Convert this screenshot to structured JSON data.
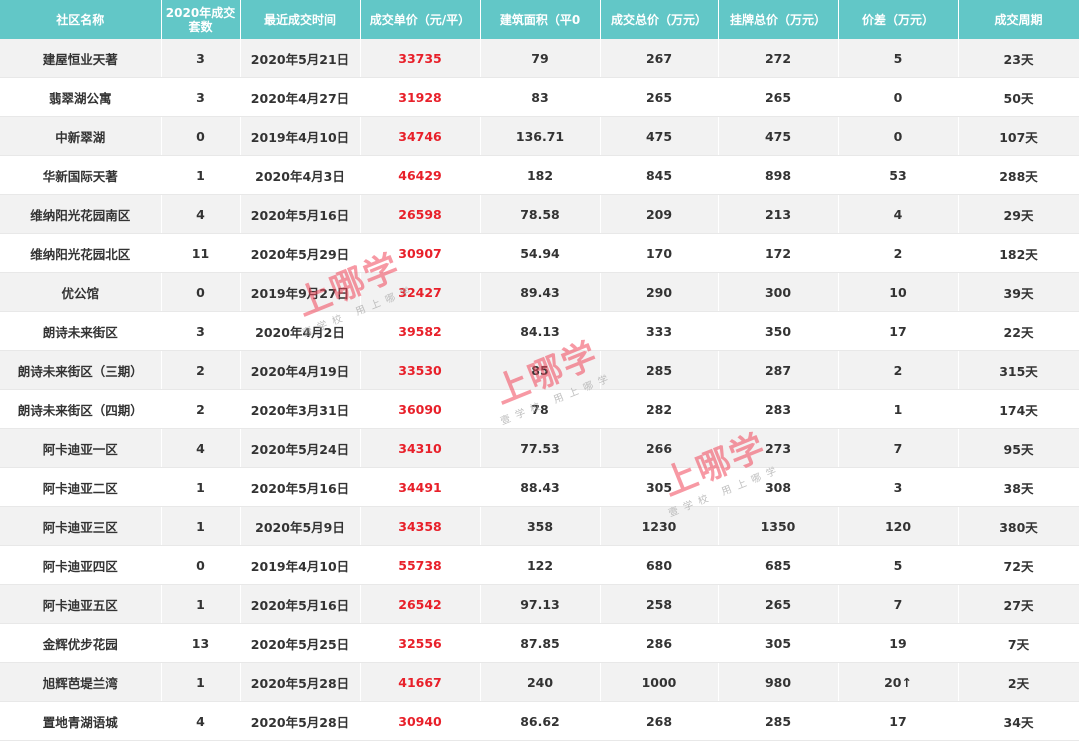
{
  "colors": {
    "header_bg": "#62c7c7",
    "price_text": "#e8202a",
    "row_alt": "#f2f2f2"
  },
  "headers": [
    "社区名称",
    "2020年成交\n套数",
    "最近成交时间",
    "成交单价（元/平）",
    "建筑面积（平0",
    "成交总价（万元）",
    "挂牌总价（万元）",
    "价差（万元）",
    "成交周期"
  ],
  "rows": [
    [
      "建屋恒业天著",
      "3",
      "2020年5月21日",
      "33735",
      "79",
      "267",
      "272",
      "5",
      "23天"
    ],
    [
      "翡翠湖公寓",
      "3",
      "2020年4月27日",
      "31928",
      "83",
      "265",
      "265",
      "0",
      "50天"
    ],
    [
      "中新翠湖",
      "0",
      "2019年4月10日",
      "34746",
      "136.71",
      "475",
      "475",
      "0",
      "107天"
    ],
    [
      "华新国际天著",
      "1",
      "2020年4月3日",
      "46429",
      "182",
      "845",
      "898",
      "53",
      "288天"
    ],
    [
      "维纳阳光花园南区",
      "4",
      "2020年5月16日",
      "26598",
      "78.58",
      "209",
      "213",
      "4",
      "29天"
    ],
    [
      "维纳阳光花园北区",
      "11",
      "2020年5月29日",
      "30907",
      "54.94",
      "170",
      "172",
      "2",
      "182天"
    ],
    [
      "优公馆",
      "0",
      "2019年9月27日",
      "32427",
      "89.43",
      "290",
      "300",
      "10",
      "39天"
    ],
    [
      "朗诗未来街区",
      "3",
      "2020年4月2日",
      "39582",
      "84.13",
      "333",
      "350",
      "17",
      "22天"
    ],
    [
      "朗诗未来街区（三期）",
      "2",
      "2020年4月19日",
      "33530",
      "85",
      "285",
      "287",
      "2",
      "315天"
    ],
    [
      "朗诗未来街区（四期）",
      "2",
      "2020年3月31日",
      "36090",
      "78",
      "282",
      "283",
      "1",
      "174天"
    ],
    [
      "阿卡迪亚一区",
      "4",
      "2020年5月24日",
      "34310",
      "77.53",
      "266",
      "273",
      "7",
      "95天"
    ],
    [
      "阿卡迪亚二区",
      "1",
      "2020年5月16日",
      "34491",
      "88.43",
      "305",
      "308",
      "3",
      "38天"
    ],
    [
      "阿卡迪亚三区",
      "1",
      "2020年5月9日",
      "34358",
      "358",
      "1230",
      "1350",
      "120",
      "380天"
    ],
    [
      "阿卡迪亚四区",
      "0",
      "2019年4月10日",
      "55738",
      "122",
      "680",
      "685",
      "5",
      "72天"
    ],
    [
      "阿卡迪亚五区",
      "1",
      "2020年5月16日",
      "26542",
      "97.13",
      "258",
      "265",
      "7",
      "27天"
    ],
    [
      "金辉优步花园",
      "13",
      "2020年5月25日",
      "32556",
      "87.85",
      "286",
      "305",
      "19",
      "7天"
    ],
    [
      "旭辉芭堤兰湾",
      "1",
      "2020年5月28日",
      "41667",
      "240",
      "1000",
      "980",
      "20↑",
      "2天"
    ],
    [
      "置地青湖语城",
      "4",
      "2020年5月28日",
      "30940",
      "86.62",
      "268",
      "285",
      "17",
      "34天"
    ]
  ],
  "watermark": {
    "main": "上哪学",
    "sub": "壹学校 用上哪学"
  }
}
